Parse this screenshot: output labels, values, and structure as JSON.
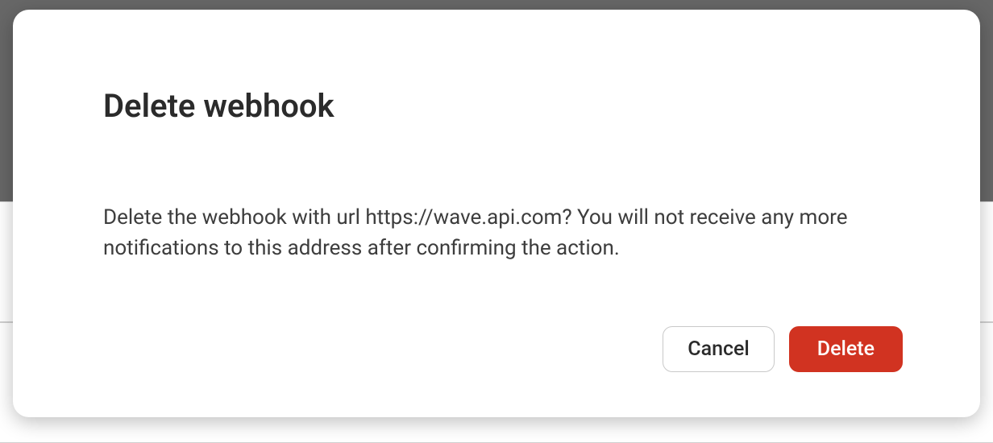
{
  "dialog": {
    "title": "Delete webhook",
    "body": "Delete the webhook with url https://wave.api.com? You will not receive any more notifications to this address after confirming the action.",
    "actions": {
      "cancel": "Cancel",
      "confirm": "Delete"
    }
  },
  "colors": {
    "danger": "#d13321"
  }
}
